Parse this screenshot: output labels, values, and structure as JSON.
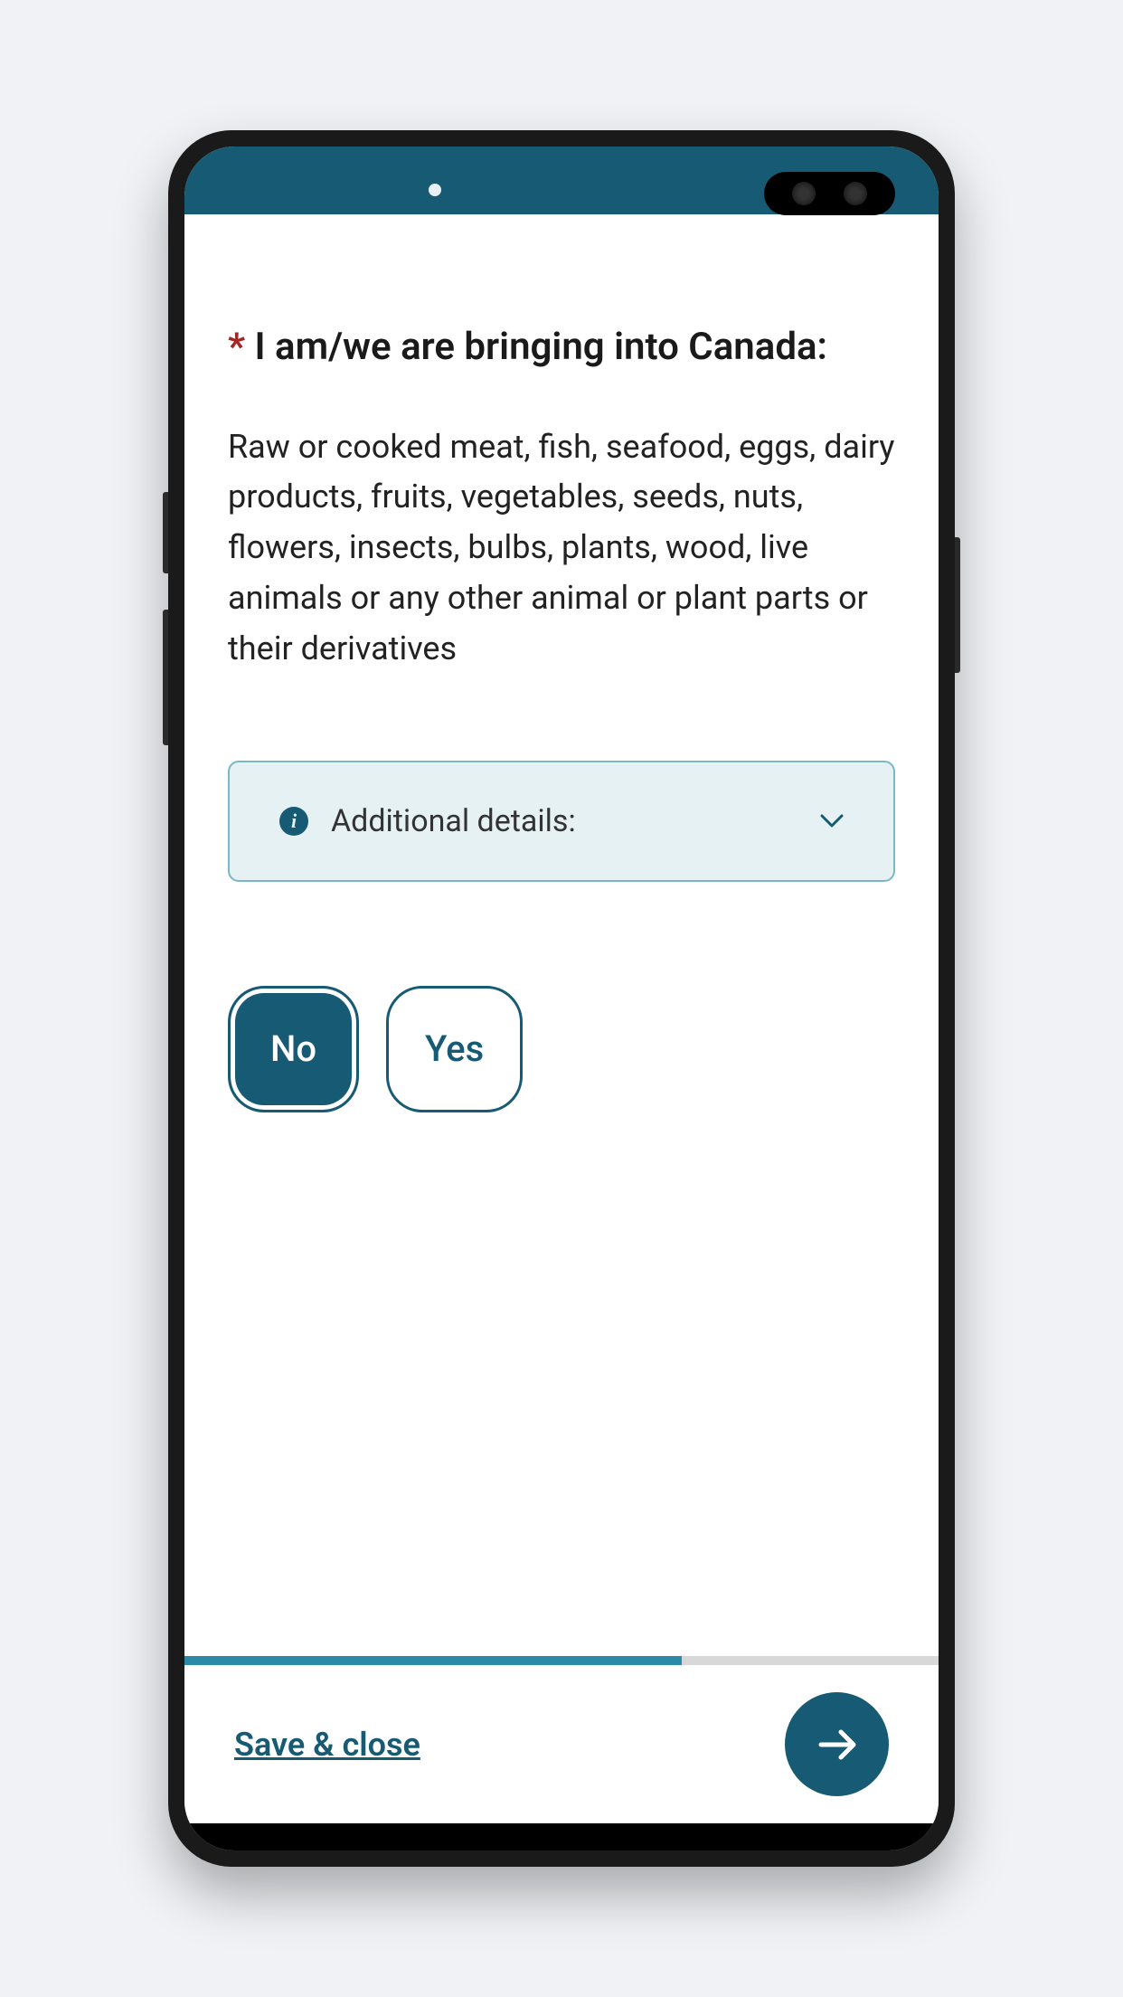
{
  "question": {
    "required_marker": "*",
    "heading": " I am/we are bringing into Canada:",
    "body": "Raw or cooked meat, fish, seafood, eggs, dairy products, fruits, vegetables, seeds, nuts, flowers, insects, bulbs, plants, wood, live animals or any other animal or plant parts or their derivatives"
  },
  "details": {
    "label": "Additional details:"
  },
  "buttons": {
    "no": "No",
    "yes": "Yes"
  },
  "footer": {
    "save_close": "Save & close"
  }
}
